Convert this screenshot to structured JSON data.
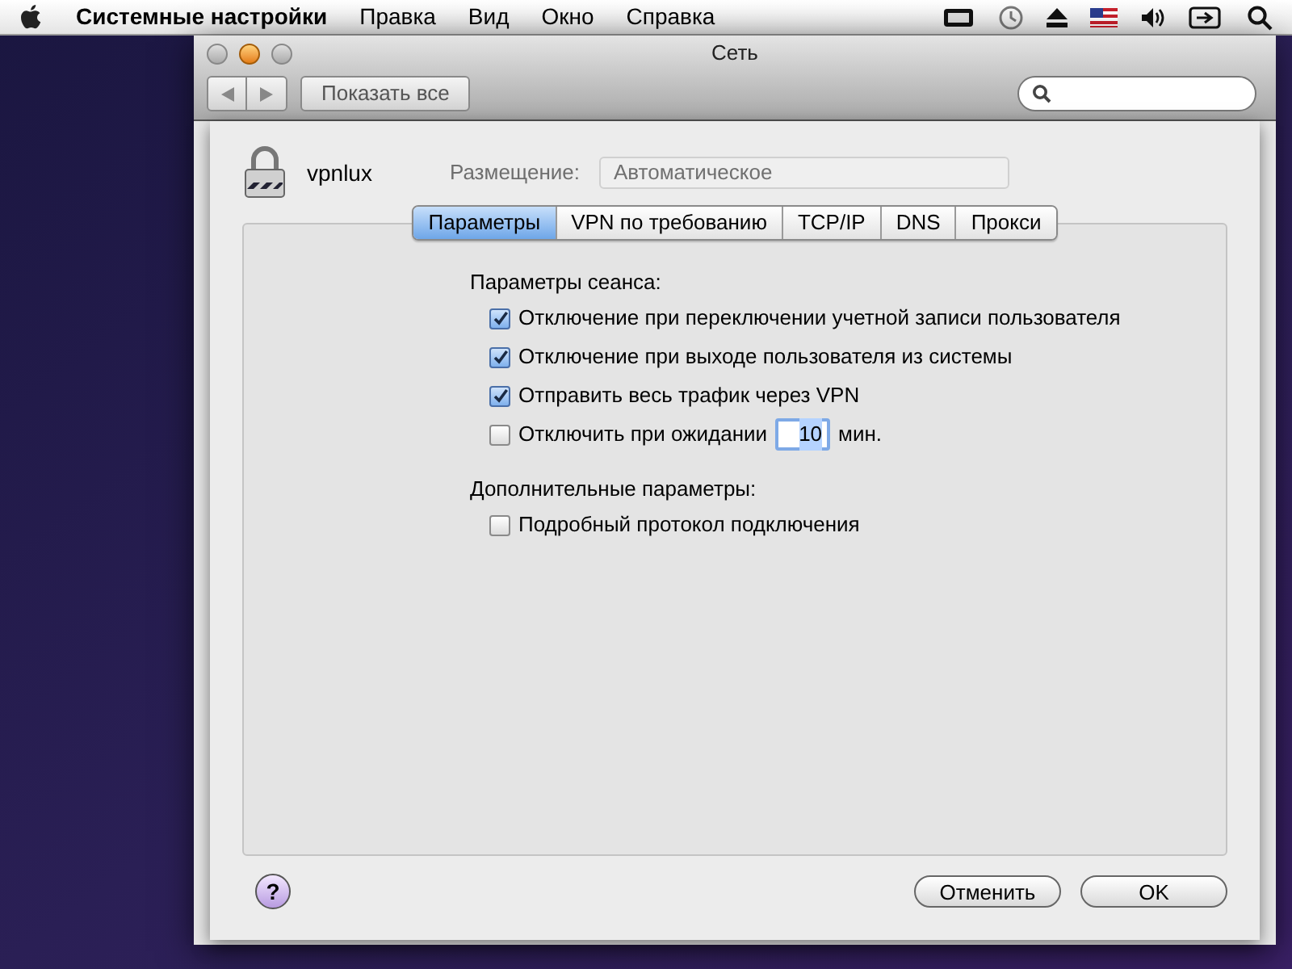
{
  "menubar": {
    "app": "Системные настройки",
    "menus": [
      "Правка",
      "Вид",
      "Окно",
      "Справка"
    ]
  },
  "window": {
    "title": "Сеть",
    "show_all": "Показать все"
  },
  "header": {
    "name": "vpnlux",
    "location_label": "Размещение:",
    "location_value": "Автоматическое"
  },
  "tabs": [
    {
      "label": "Параметры",
      "selected": true
    },
    {
      "label": "VPN по требованию",
      "selected": false
    },
    {
      "label": "TCP/IP",
      "selected": false
    },
    {
      "label": "DNS",
      "selected": false
    },
    {
      "label": "Прокси",
      "selected": false
    }
  ],
  "groups": [
    {
      "title": "Параметры сеанса:",
      "options": [
        {
          "kind": "check",
          "label": "Отключение при переключении учетной записи пользователя",
          "checked": true
        },
        {
          "kind": "check",
          "label": "Отключение при выходе пользователя из системы",
          "checked": true
        },
        {
          "kind": "check",
          "label": "Отправить весь трафик через VPN",
          "checked": true
        },
        {
          "kind": "timeout",
          "label": "Отключить при ожидании",
          "checked": false,
          "value": "10",
          "unit": "мин."
        }
      ]
    },
    {
      "title": "Дополнительные параметры:",
      "options": [
        {
          "kind": "check",
          "label": "Подробный протокол подключения",
          "checked": false
        }
      ]
    }
  ],
  "buttons": {
    "help": "?",
    "cancel": "Отменить",
    "ok": "OK"
  }
}
